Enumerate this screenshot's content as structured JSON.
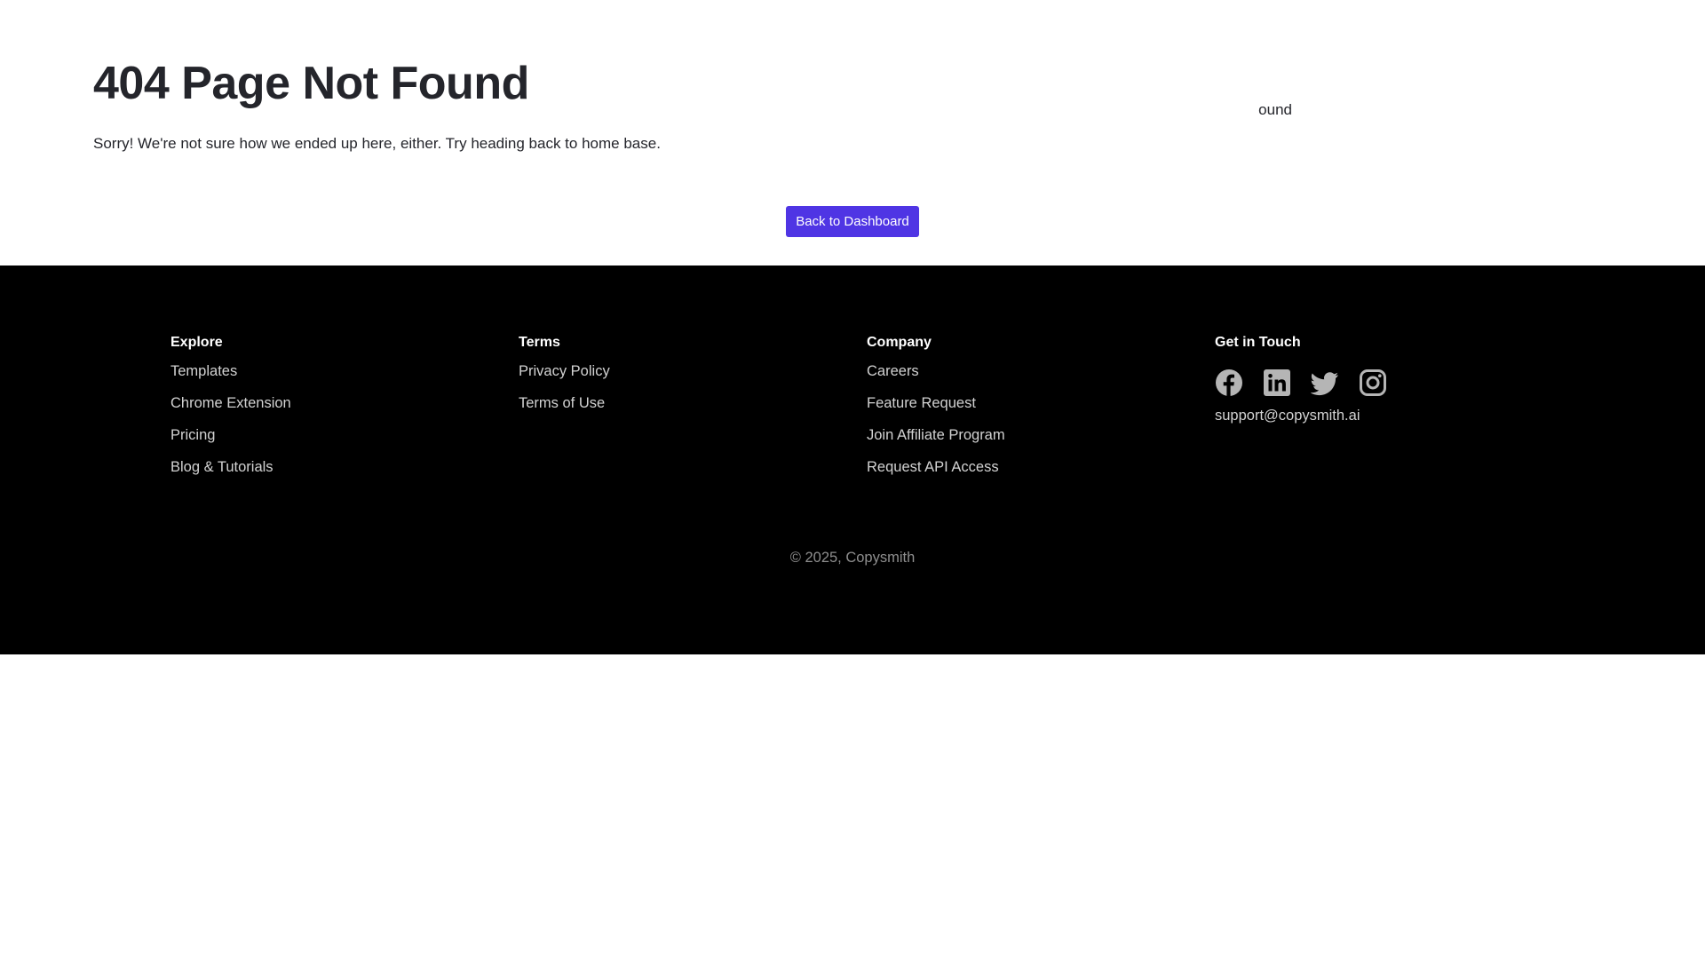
{
  "hero": {
    "title": "404 Page Not Found",
    "message": "Sorry! We're not sure how we ended up here, either. Try heading back to home base.",
    "clipped_label": "ound",
    "button_label": "Back to Dashboard"
  },
  "colors": {
    "accent": "#4f35e4",
    "footer_bg": "#000000",
    "footer_text": "#d2d2d2",
    "icon": "#b5b5b5"
  },
  "footer": {
    "columns": [
      {
        "heading": "Explore",
        "links": [
          "Templates",
          "Chrome Extension",
          "Pricing",
          "Blog & Tutorials"
        ]
      },
      {
        "heading": "Terms",
        "links": [
          "Privacy Policy",
          "Terms of Use"
        ]
      },
      {
        "heading": "Company",
        "links": [
          "Careers",
          "Feature Request",
          "Join Affiliate Program",
          "Request API Access"
        ]
      },
      {
        "heading": "Get in Touch",
        "social": [
          "facebook-icon",
          "linkedin-icon",
          "twitter-icon",
          "instagram-icon"
        ],
        "email": "support@copysmith.ai"
      }
    ],
    "copyright": "© 2025, Copysmith"
  }
}
